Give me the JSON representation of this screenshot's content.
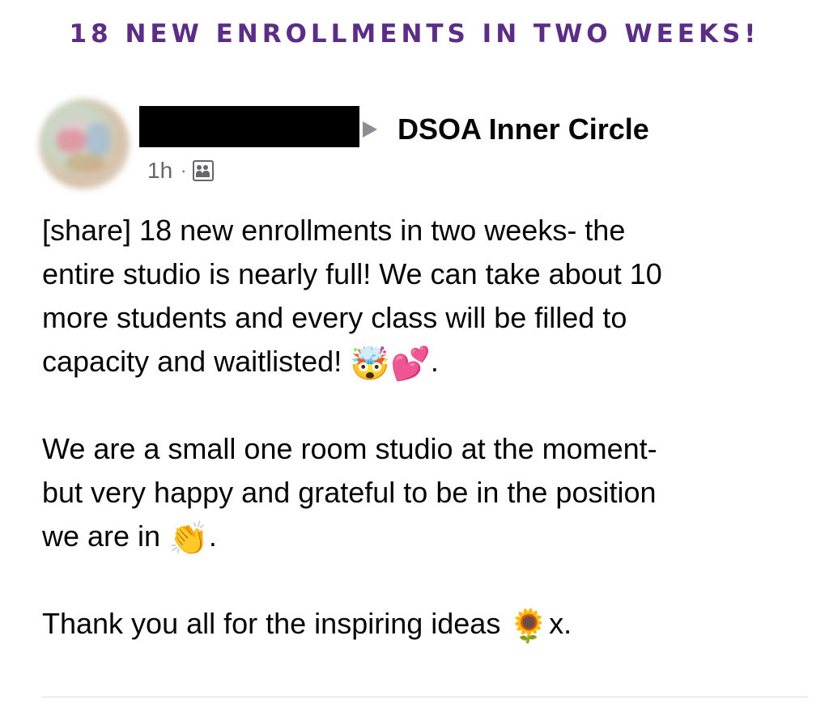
{
  "headline": "18 NEW ENROLLMENTS IN TWO WEEKS!",
  "post": {
    "author_redacted": true,
    "group_name": "DSOA Inner Circle",
    "timestamp": "1h",
    "separator": "·",
    "audience_icon": "group-icon",
    "paragraph1": {
      "lines": [
        "[share] 18 new enrollments in two weeks- the",
        "entire studio is nearly full! We can take about 10",
        "more students and every class will be filled to"
      ],
      "last_line_text": "capacity and waitlisted! ",
      "emoji_1": "🤯",
      "emoji_2": "💕",
      "end": "."
    },
    "paragraph2": {
      "lines": [
        "We are a small one room studio at the moment-",
        "but very happy and grateful to be in the position"
      ],
      "last_line_text": "we are in ",
      "emoji": "👏",
      "end": "."
    },
    "paragraph3": {
      "text": "Thank you all for the inspiring ideas ",
      "emoji": "🌻",
      "end": "x."
    }
  }
}
